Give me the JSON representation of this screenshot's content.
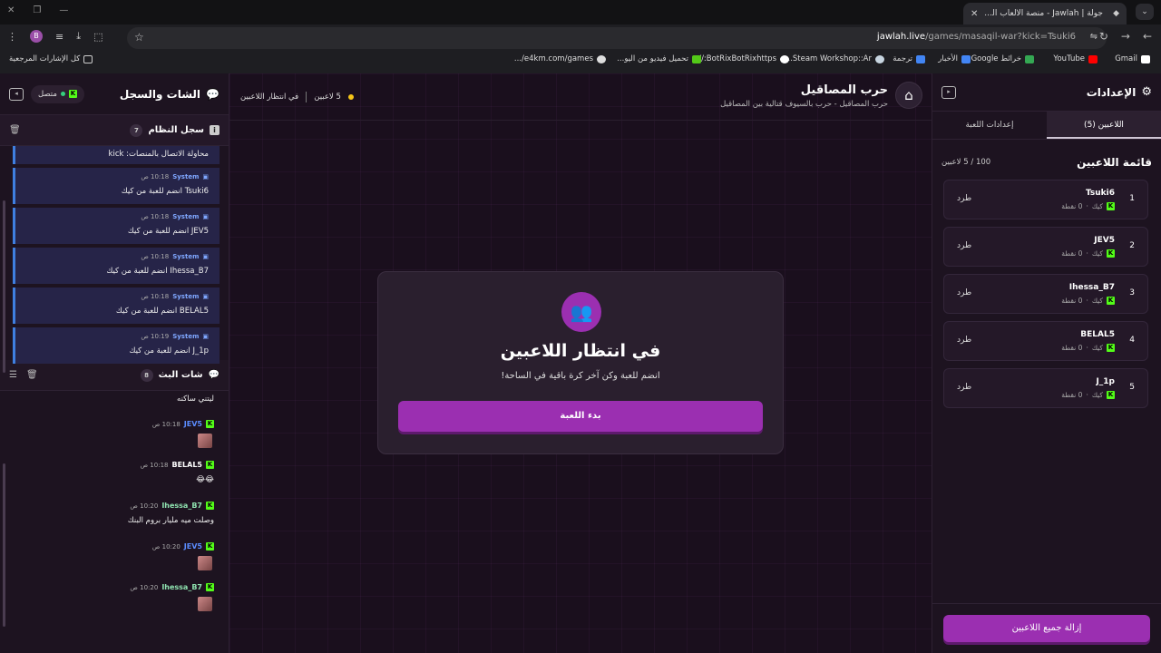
{
  "browser": {
    "tab_title": "جولة | Jawlah - منصة الألعاب الت...",
    "url_host": "jawlah.live",
    "url_path": "/games/masaqil-war?kick=Tsuki6",
    "bookmarks": [
      "Gmail",
      "YouTube",
      "خرائط Google",
      "الأخبار",
      "ترجمة",
      "Steam Workshop::Ar...",
      "BotRixBotRixhttps://...",
      "تحميل فيديو من اليو...",
      "e4km.com/games/...",
      "كل الإشارات المرجعية"
    ]
  },
  "settings": {
    "title": "الإعدادات",
    "tab_players": "اللاعبين (5)",
    "tab_game": "إعدادات اللعبة",
    "list_title": "قائمة اللاعبين",
    "count": "100 / 5 لاعبين",
    "players": [
      {
        "rank": "1",
        "name": "Tsuki6",
        "platform": "كيك",
        "points": "0 نقطة",
        "kick": "طرد"
      },
      {
        "rank": "2",
        "name": "JEV5",
        "platform": "كيك",
        "points": "0 نقطة",
        "kick": "طرد"
      },
      {
        "rank": "3",
        "name": "Ihessa_B7",
        "platform": "كيك",
        "points": "0 نقطة",
        "kick": "طرد"
      },
      {
        "rank": "4",
        "name": "BELAL5",
        "platform": "كيك",
        "points": "0 نقطة",
        "kick": "طرد"
      },
      {
        "rank": "5",
        "name": "J_1p",
        "platform": "كيك",
        "points": "0 نقطة",
        "kick": "طرد"
      }
    ],
    "remove_all": "إزالة جميع اللاعبين"
  },
  "game": {
    "title": "حرب المصاقيل",
    "subtitle": "حرب المصاقيل - حرب بالسيوف قتالية بين المصاقيل",
    "players_count": "5 لاعبين",
    "state": "في انتظار اللاعبين",
    "card_title": "في انتظار اللاعبين",
    "card_text": "انضم للعبة وكن آخر كرة باقية في الساحة!",
    "start_button": "بدء اللعبة"
  },
  "chat": {
    "title": "الشات والسجل",
    "online": "متصل",
    "system_log_title": "سجل النظام",
    "system_log_count": "7",
    "system_entries": [
      {
        "who": "",
        "time": "",
        "msg": "محاولة الاتصال بالمنصات: kick"
      },
      {
        "who": "System",
        "time": "10:18 ص",
        "msg": "Tsuki6 انضم للعبة من كيك"
      },
      {
        "who": "System",
        "time": "10:18 ص",
        "msg": "JEV5 انضم للعبة من كيك"
      },
      {
        "who": "System",
        "time": "10:18 ص",
        "msg": "Ihessa_B7 انضم للعبة من كيك"
      },
      {
        "who": "System",
        "time": "10:18 ص",
        "msg": "BELAL5 انضم للعبة من كيك"
      },
      {
        "who": "System",
        "time": "10:19 ص",
        "msg": "J_1p انضم للعبة من كيك"
      }
    ],
    "stream_chat_title": "شات البث",
    "stream_chat_count": "8",
    "messages": [
      {
        "who": "",
        "time": "",
        "text": "ليتني ساكنه"
      },
      {
        "who": "JEV5",
        "time": "10:18 ص",
        "text": "",
        "color": "#5b8cff"
      },
      {
        "who": "BELAL5",
        "time": "10:18 ص",
        "text": "😂😂",
        "color": "#ffffff"
      },
      {
        "who": "Ihessa_B7",
        "time": "10:20 ص",
        "text": "وصلت ميه مليار بروم البنك",
        "color": "#8fe3b0"
      },
      {
        "who": "JEV5",
        "time": "10:20 ص",
        "text": "",
        "color": "#5b8cff"
      },
      {
        "who": "Ihessa_B7",
        "time": "10:20 ص",
        "text": "",
        "color": "#8fe3b0"
      }
    ]
  }
}
